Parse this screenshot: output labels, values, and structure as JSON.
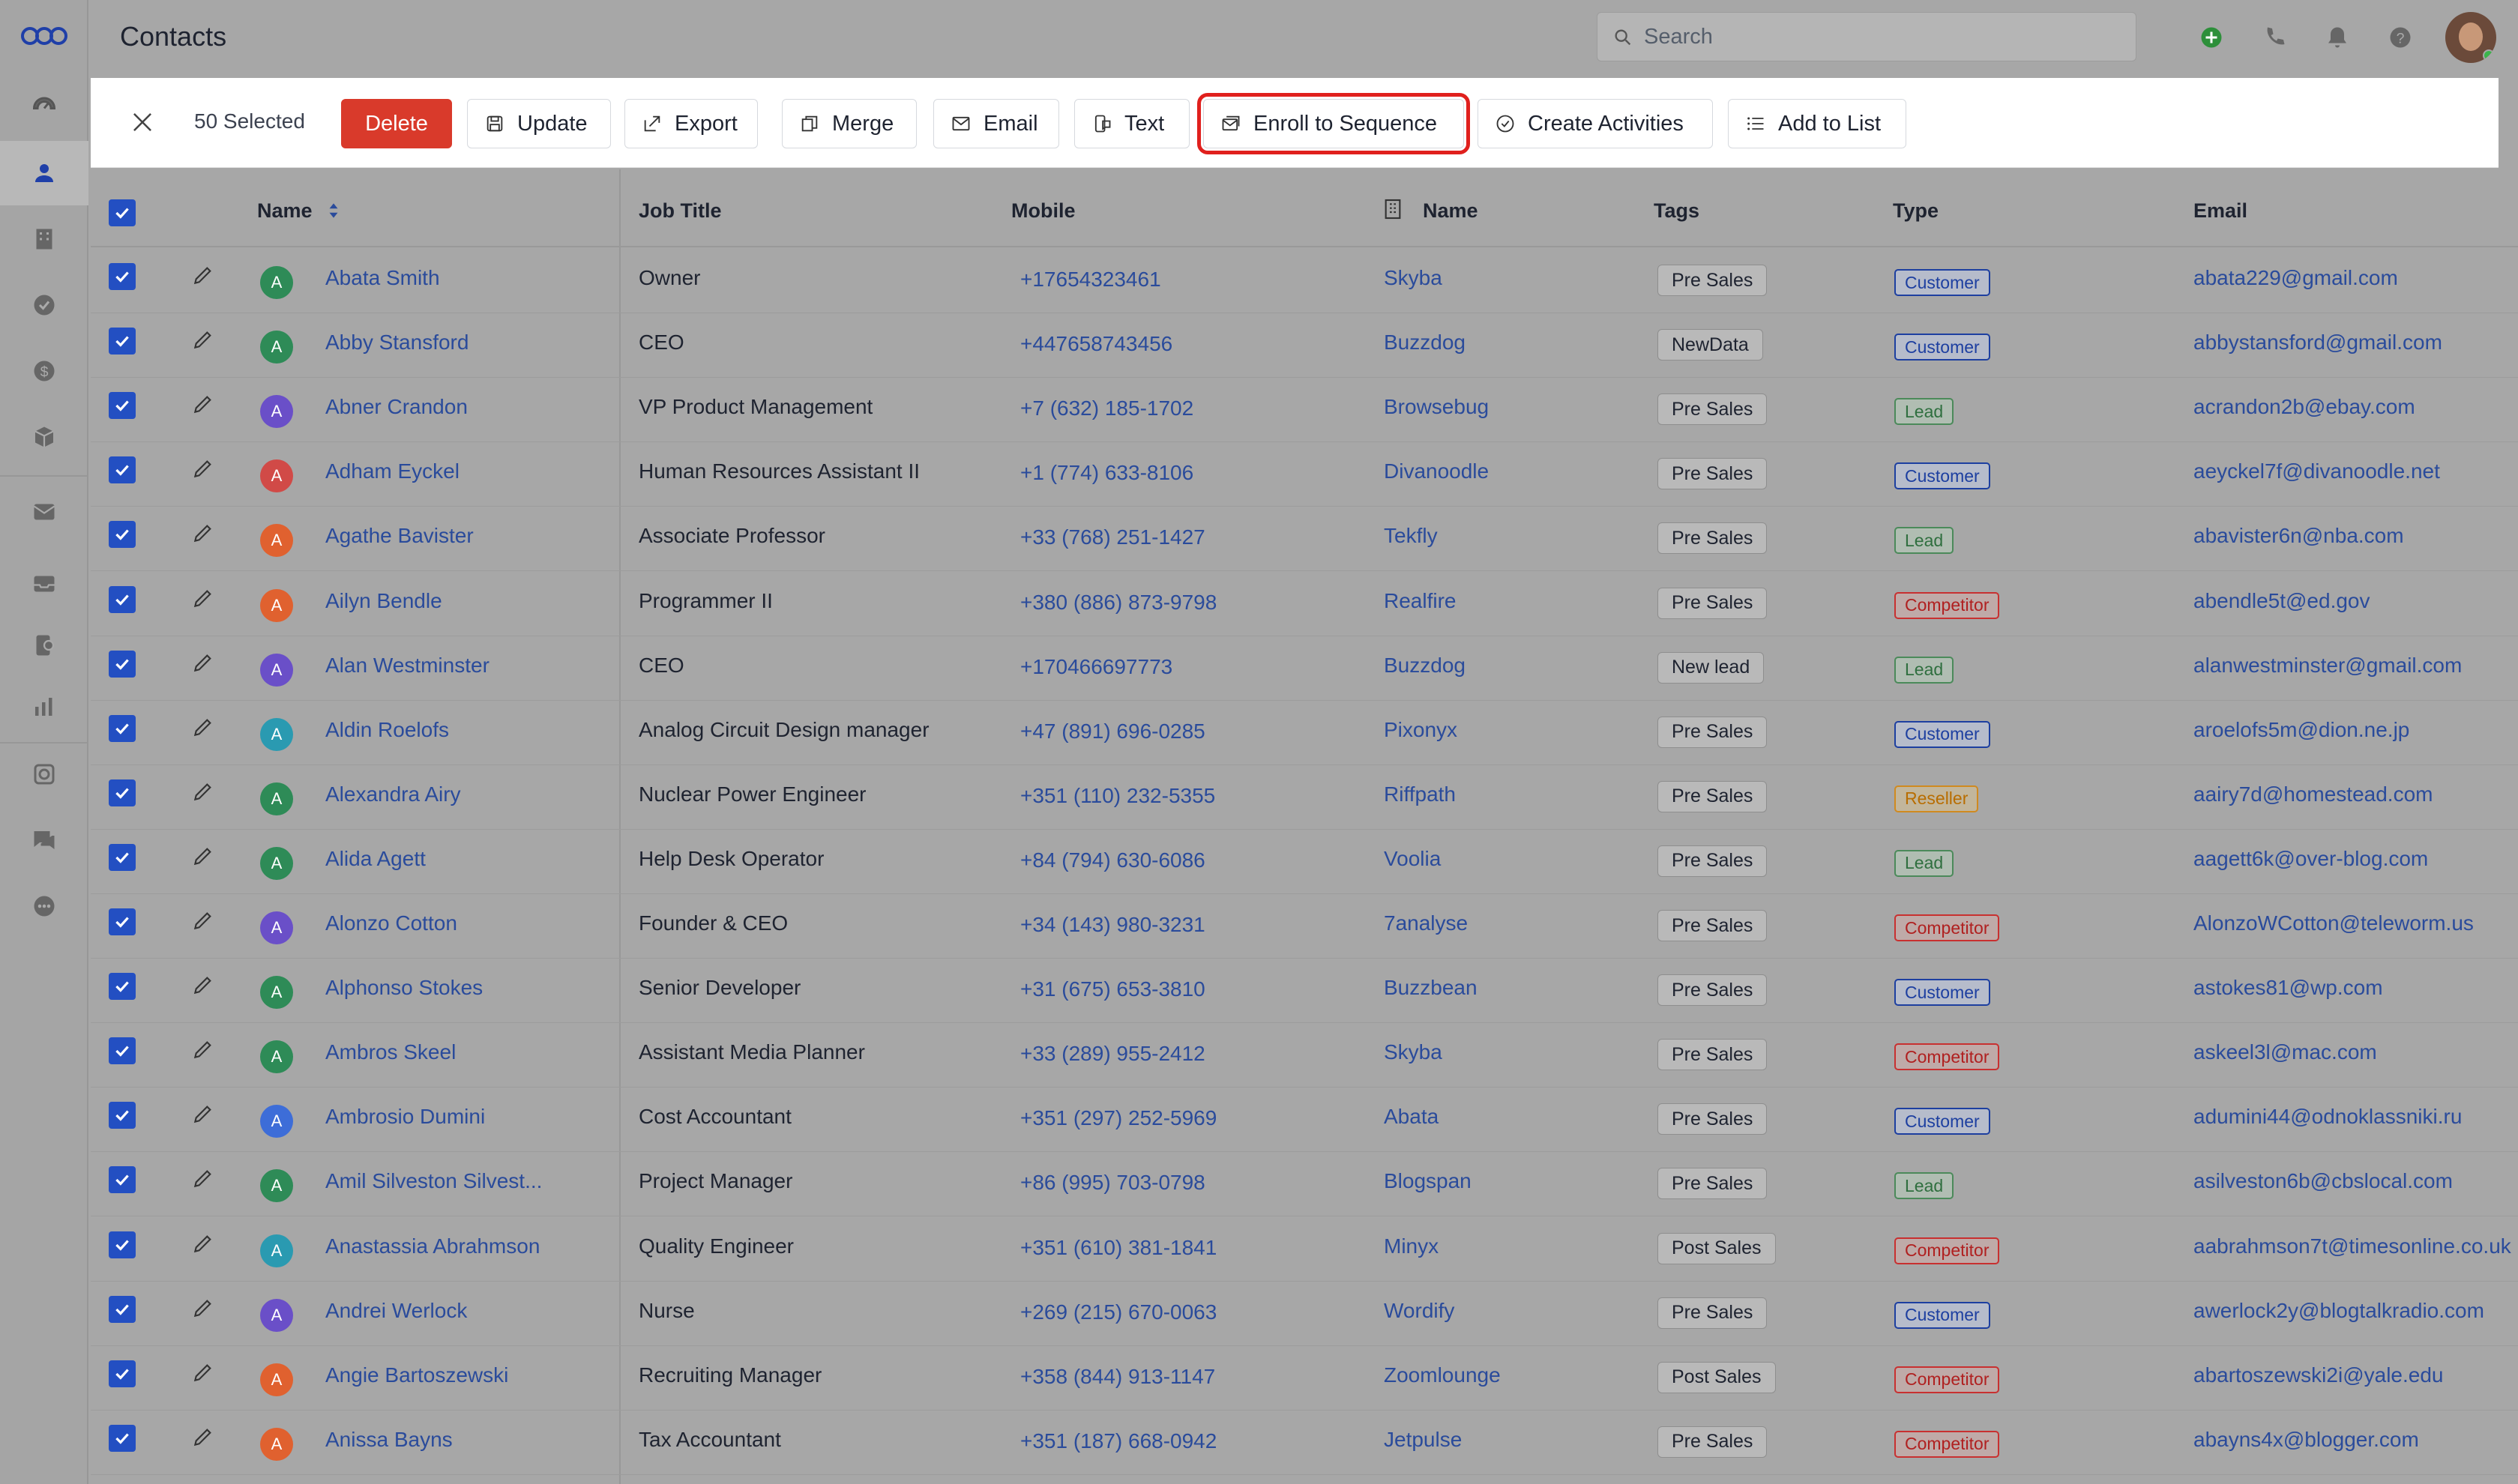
{
  "header": {
    "title": "Contacts",
    "search_placeholder": "Search"
  },
  "actionbar": {
    "selected": "50 Selected",
    "buttons": {
      "delete": "Delete",
      "update": "Update",
      "export": "Export",
      "merge": "Merge",
      "email": "Email",
      "text": "Text",
      "enroll": "Enroll to Sequence",
      "activities": "Create Activities",
      "addlist": "Add to List"
    }
  },
  "columns": {
    "name": "Name",
    "job": "Job Title",
    "mobile": "Mobile",
    "company": "Name",
    "tags": "Tags",
    "type": "Type",
    "email": "Email"
  },
  "colors": {
    "green": "#2e8b57",
    "purple": "#6a4fc8",
    "red": "#d14a47",
    "orange": "#e0612f",
    "teal": "#2a9ab1",
    "blue": "#3d6dd8"
  },
  "rows": [
    {
      "name": "Abata Smith",
      "avatar_color": "green",
      "job": "Owner",
      "mobile": "+17654323461",
      "company": "Skyba",
      "tag": "Pre Sales",
      "type": "Customer",
      "email": "abata229@gmail.com"
    },
    {
      "name": "Abby Stansford",
      "avatar_color": "green",
      "job": "CEO",
      "mobile": "+447658743456",
      "company": "Buzzdog",
      "tag": "NewData",
      "type": "Customer",
      "email": "abbystansford@gmail.com"
    },
    {
      "name": "Abner Crandon",
      "avatar_color": "purple",
      "job": "VP Product Management",
      "mobile": "+7 (632) 185-1702",
      "company": "Browsebug",
      "tag": "Pre Sales",
      "type": "Lead",
      "email": "acrandon2b@ebay.com"
    },
    {
      "name": "Adham Eyckel",
      "avatar_color": "red",
      "job": "Human Resources Assistant II",
      "mobile": "+1 (774) 633-8106",
      "company": "Divanoodle",
      "tag": "Pre Sales",
      "type": "Customer",
      "email": "aeyckel7f@divanoodle.net"
    },
    {
      "name": "Agathe Bavister",
      "avatar_color": "orange",
      "job": "Associate Professor",
      "mobile": "+33 (768) 251-1427",
      "company": "Tekfly",
      "tag": "Pre Sales",
      "type": "Lead",
      "email": "abavister6n@nba.com"
    },
    {
      "name": "Ailyn Bendle",
      "avatar_color": "orange",
      "job": "Programmer II",
      "mobile": "+380 (886) 873-9798",
      "company": "Realfire",
      "tag": "Pre Sales",
      "type": "Competitor",
      "email": "abendle5t@ed.gov"
    },
    {
      "name": "Alan Westminster",
      "avatar_color": "purple",
      "job": "CEO",
      "mobile": "+170466697773",
      "company": "Buzzdog",
      "tag": "New lead",
      "type": "Lead",
      "email": "alanwestminster@gmail.com"
    },
    {
      "name": "Aldin Roelofs",
      "avatar_color": "teal",
      "job": "Analog Circuit Design manager",
      "mobile": "+47 (891) 696-0285",
      "company": "Pixonyx",
      "tag": "Pre Sales",
      "type": "Customer",
      "email": "aroelofs5m@dion.ne.jp"
    },
    {
      "name": "Alexandra Airy",
      "avatar_color": "green",
      "job": "Nuclear Power Engineer",
      "mobile": "+351 (110) 232-5355",
      "company": "Riffpath",
      "tag": "Pre Sales",
      "type": "Reseller",
      "email": "aairy7d@homestead.com"
    },
    {
      "name": "Alida Agett",
      "avatar_color": "green",
      "job": "Help Desk Operator",
      "mobile": "+84 (794) 630-6086",
      "company": "Voolia",
      "tag": "Pre Sales",
      "type": "Lead",
      "email": "aagett6k@over-blog.com"
    },
    {
      "name": "Alonzo Cotton",
      "avatar_color": "purple",
      "job": "Founder & CEO",
      "mobile": "+34 (143) 980-3231",
      "company": "7analyse",
      "tag": "Pre Sales",
      "type": "Competitor",
      "email": "AlonzoWCotton@teleworm.us"
    },
    {
      "name": "Alphonso Stokes",
      "avatar_color": "green",
      "job": "Senior Developer",
      "mobile": "+31 (675) 653-3810",
      "company": "Buzzbean",
      "tag": "Pre Sales",
      "type": "Customer",
      "email": "astokes81@wp.com"
    },
    {
      "name": "Ambros Skeel",
      "avatar_color": "green",
      "job": "Assistant Media Planner",
      "mobile": "+33 (289) 955-2412",
      "company": "Skyba",
      "tag": "Pre Sales",
      "type": "Competitor",
      "email": "askeel3l@mac.com"
    },
    {
      "name": "Ambrosio Dumini",
      "avatar_color": "blue",
      "job": "Cost Accountant",
      "mobile": "+351 (297) 252-5969",
      "company": "Abata",
      "tag": "Pre Sales",
      "type": "Customer",
      "email": "adumini44@odnoklassniki.ru"
    },
    {
      "name": "Amil Silveston Silvest...",
      "avatar_color": "green",
      "job": "Project Manager",
      "mobile": "+86 (995) 703-0798",
      "company": "Blogspan",
      "tag": "Pre Sales",
      "type": "Lead",
      "email": "asilveston6b@cbslocal.com"
    },
    {
      "name": "Anastassia Abrahmson",
      "avatar_color": "teal",
      "job": "Quality Engineer",
      "mobile": "+351 (610) 381-1841",
      "company": "Minyx",
      "tag": "Post Sales",
      "type": "Competitor",
      "email": "aabrahmson7t@timesonline.co.uk"
    },
    {
      "name": "Andrei Werlock",
      "avatar_color": "purple",
      "job": "Nurse",
      "mobile": "+269 (215) 670-0063",
      "company": "Wordify",
      "tag": "Pre Sales",
      "type": "Customer",
      "email": "awerlock2y@blogtalkradio.com"
    },
    {
      "name": "Angie Bartoszewski",
      "avatar_color": "orange",
      "job": "Recruiting Manager",
      "mobile": "+358 (844) 913-1147",
      "company": "Zoomlounge",
      "tag": "Post Sales",
      "type": "Competitor",
      "email": "abartoszewski2i@yale.edu"
    },
    {
      "name": "Anissa Bayns",
      "avatar_color": "orange",
      "job": "Tax Accountant",
      "mobile": "+351 (187) 668-0942",
      "company": "Jetpulse",
      "tag": "Pre Sales",
      "type": "Competitor",
      "email": "abayns4x@blogger.com"
    }
  ]
}
